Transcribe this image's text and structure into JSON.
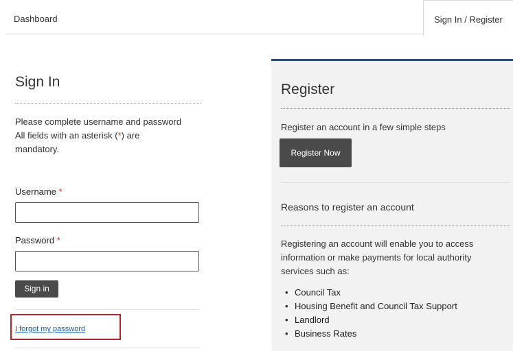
{
  "tabs": {
    "dashboard": "Dashboard",
    "signin_register": "Sign In / Register"
  },
  "signin": {
    "title": "Sign In",
    "instruction": "Please complete username and password",
    "mandatory_prefix": "All fields with an asterisk (",
    "mandatory_asterisk": "*",
    "mandatory_suffix": ") are",
    "mandatory_line2": "mandatory.",
    "username_label": "Username",
    "password_label": "Password",
    "required_mark": "*",
    "signin_button": "Sign in",
    "forgot_link": "I forgot my password"
  },
  "register": {
    "title": "Register",
    "intro": "Register an account in a few simple steps",
    "register_button": "Register Now",
    "reasons_title": "Reasons to register an account",
    "reasons_text_1": "Registering an account will enable you to access",
    "reasons_text_2": "information or make payments for local authority",
    "reasons_text_3": "services such as:",
    "services": [
      "Council Tax",
      "Housing Benefit and Council Tax Support",
      "Landlord",
      "Business Rates"
    ]
  },
  "colors": {
    "accent_border": "#2e4c7a",
    "highlight_box": "#b3232a",
    "button_bg": "#4a4a4a",
    "link": "#1a5fb4"
  }
}
